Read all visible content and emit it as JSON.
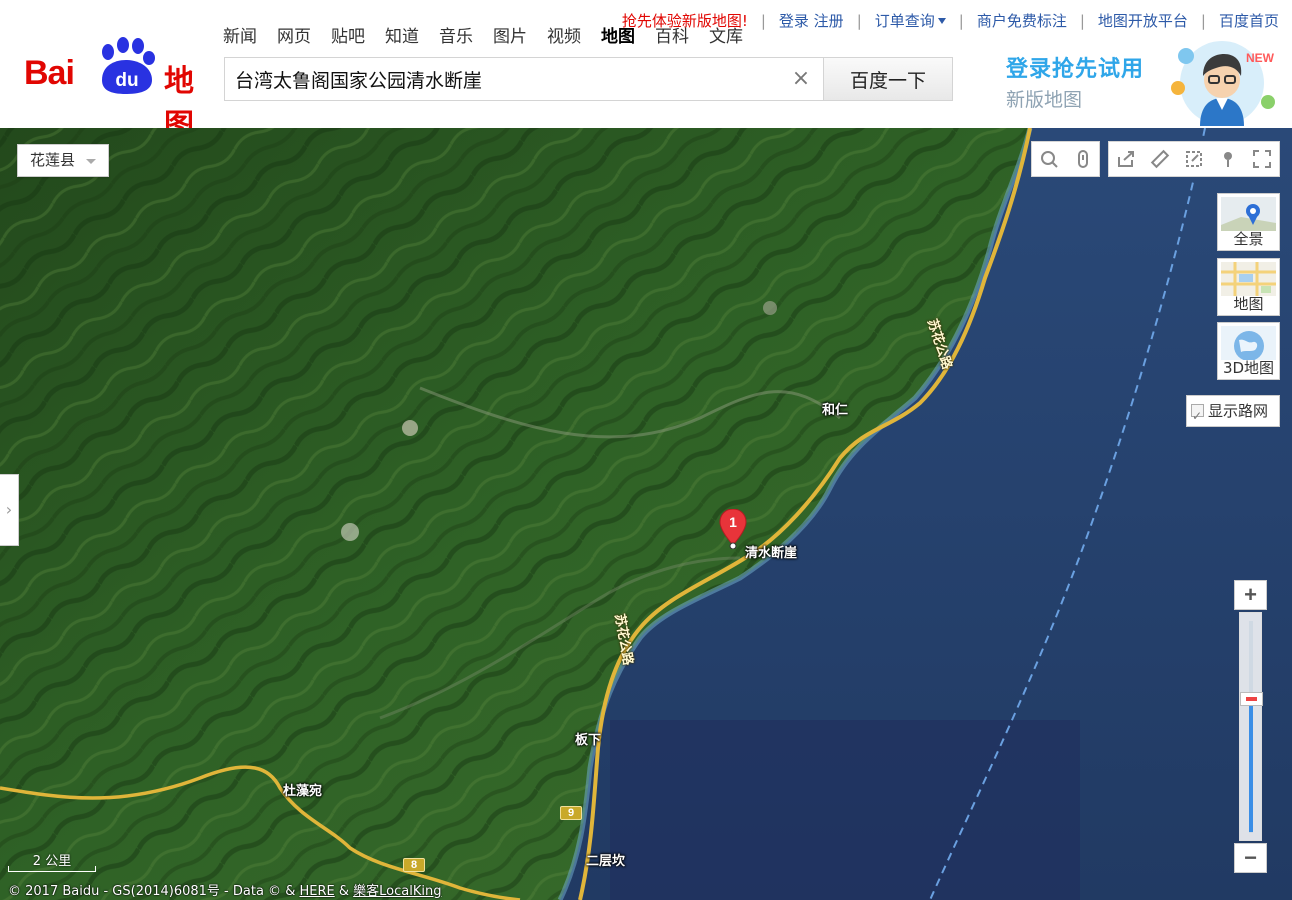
{
  "header": {
    "logo": {
      "text_left": "Bai",
      "text_paw": "du",
      "text_right": "地图"
    },
    "nav": [
      "新闻",
      "网页",
      "贴吧",
      "知道",
      "音乐",
      "图片",
      "视频",
      "地图",
      "百科",
      "文库"
    ],
    "nav_active": "地图",
    "top_links": {
      "promo": "抢先体验新版地图!",
      "login_register": "登录  注册",
      "order_query": "订单查询",
      "merchant": "商户免费标注",
      "open_platform": "地图开放平台",
      "baidu_home": "百度首页"
    },
    "search": {
      "value": "台湾太鲁阁国家公园清水断崖",
      "clear_symbol": "×",
      "button_label": "百度一下"
    },
    "banner": {
      "line1": "登录抢先试用",
      "line2": "新版地图",
      "badge": "NEW"
    }
  },
  "map": {
    "city_select": "花莲县",
    "left_toggle": "›",
    "map_types": [
      {
        "id": "pano",
        "label": "全景"
      },
      {
        "id": "map",
        "label": "地图"
      },
      {
        "id": "3d",
        "label": "3D地图"
      }
    ],
    "show_roads_label": "显示路网",
    "show_roads_checked": true,
    "zoom": {
      "plus": "+",
      "minus": "−",
      "level_fraction": 0.63
    },
    "scale_label": "2 公里",
    "copyright": {
      "prefix": "© 2017 Baidu - GS(2014)6081号 - Data © & ",
      "here": "HERE",
      "amp": " & ",
      "localking": "樂客LocalKing"
    },
    "poi": {
      "index": "1",
      "name": "清水断崖"
    },
    "place_labels": [
      {
        "name": "和仁"
      },
      {
        "name": "板下"
      },
      {
        "name": "杜藻宛"
      },
      {
        "name": "二层坎"
      }
    ],
    "road_labels": {
      "north": "苏花公路",
      "south": "苏花公路"
    },
    "route_shields": [
      "9",
      "8"
    ],
    "colors": {
      "sea": "#243e69",
      "land": "#2d5a22",
      "road": "#e0b53a",
      "accent": "#2d5aa8",
      "brand_red": "#e10602"
    }
  }
}
